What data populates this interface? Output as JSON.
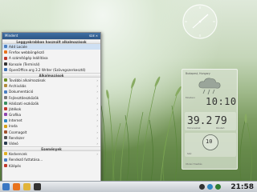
{
  "menu": {
    "header_left": "Mindent",
    "header_right": "SDE ✕",
    "sections": [
      {
        "title": "Leggyakrabban használt alkalmazások",
        "items": [
          {
            "label": "Add Locale",
            "icon": "globe-icon",
            "color": "#4a7fc1",
            "submenu": false
          },
          {
            "label": "Firefox webböngésző",
            "icon": "firefox-icon",
            "color": "#e8731d",
            "submenu": false
          },
          {
            "label": "A számítógép leállítása",
            "icon": "power-icon",
            "color": "#c0392b",
            "submenu": false
          },
          {
            "label": "Konsole (Terminál)",
            "icon": "terminal-icon",
            "color": "#333333",
            "submenu": false
          },
          {
            "label": "OpenOffice.org 3.2 Writer (Szövegszerkesztő)",
            "icon": "writer-icon",
            "color": "#3a6fb0",
            "submenu": false
          }
        ]
      },
      {
        "title": "Alkalmazások",
        "items": [
          {
            "label": "További alkalmazások",
            "icon": "apps-icon",
            "color": "#6b8e23",
            "submenu": true
          },
          {
            "label": "Archiválás",
            "icon": "archive-icon",
            "color": "#b08a3a",
            "submenu": true
          },
          {
            "label": "Dokumentáció",
            "icon": "document-icon",
            "color": "#4a7fc1",
            "submenu": true
          },
          {
            "label": "Fejlesztőeszközök",
            "icon": "tools-icon",
            "color": "#7a7a7a",
            "submenu": true
          },
          {
            "label": "Hálózati eszközök",
            "icon": "network-icon",
            "color": "#3a8f5e",
            "submenu": true
          },
          {
            "label": "Játékok",
            "icon": "games-icon",
            "color": "#c0392b",
            "submenu": true
          },
          {
            "label": "Grafika",
            "icon": "graphics-icon",
            "color": "#8e44ad",
            "submenu": true
          },
          {
            "label": "Internet",
            "icon": "internet-icon",
            "color": "#2e86c1",
            "submenu": true
          },
          {
            "label": "Iroda",
            "icon": "office-icon",
            "color": "#d4a017",
            "submenu": true
          },
          {
            "label": "Csomagolt",
            "icon": "package-icon",
            "color": "#a0522d",
            "submenu": true
          },
          {
            "label": "Rendszer",
            "icon": "system-icon",
            "color": "#555555",
            "submenu": true
          },
          {
            "label": "Videó",
            "icon": "video-icon",
            "color": "#2c3e50",
            "submenu": true
          }
        ]
      },
      {
        "title": "Események",
        "items": [
          {
            "label": "Kedvencek",
            "icon": "star-icon",
            "color": "#e0b020",
            "submenu": true
          },
          {
            "label": "Rendező futtatása...",
            "icon": "run-icon",
            "color": "#4a7fc1",
            "submenu": false
          },
          {
            "label": "Kilépés",
            "icon": "logout-icon",
            "color": "#c0392b",
            "submenu": false
          }
        ]
      }
    ]
  },
  "weather": {
    "location": "Budapest, Hungary",
    "time": "10:10",
    "small_label": "Mostani",
    "temperature": "39.2",
    "temperature_caption": "Hőmérséklet",
    "humidity": "79",
    "humidity_caption": "Páratart.",
    "wind_speed": "10",
    "wind_caption": "Szél",
    "footer": "Utolsó frissítés"
  },
  "taskbar": {
    "clock": "21:58",
    "icons": [
      {
        "name": "kmenu-icon",
        "color": "#3b78c3"
      },
      {
        "name": "firefox-icon",
        "color": "#e8731d"
      },
      {
        "name": "folder-icon",
        "color": "#e1b43a"
      },
      {
        "name": "terminal-icon",
        "color": "#333333"
      },
      {
        "name": "tray-volume-icon",
        "color": "#333333"
      },
      {
        "name": "tray-network-icon",
        "color": "#2e86c1"
      },
      {
        "name": "tray-update-icon",
        "color": "#2e7d32"
      }
    ]
  }
}
